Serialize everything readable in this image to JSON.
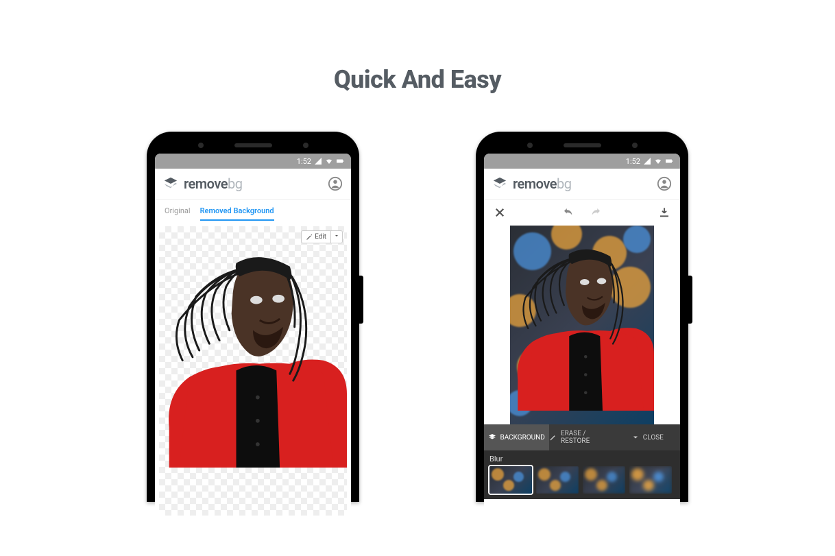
{
  "heading": "Quick And Easy",
  "brand": {
    "name1": "remove",
    "name2": "bg"
  },
  "status_bar": {
    "time": "1:52"
  },
  "phone1": {
    "tabs": {
      "original": "Original",
      "removed": "Removed Background"
    },
    "edit_label": "Edit"
  },
  "phone2": {
    "editor_tabs": {
      "background": "BACKGROUND",
      "erase": "ERASE / RESTORE",
      "close": "CLOSE"
    },
    "blur_label": "Blur"
  }
}
